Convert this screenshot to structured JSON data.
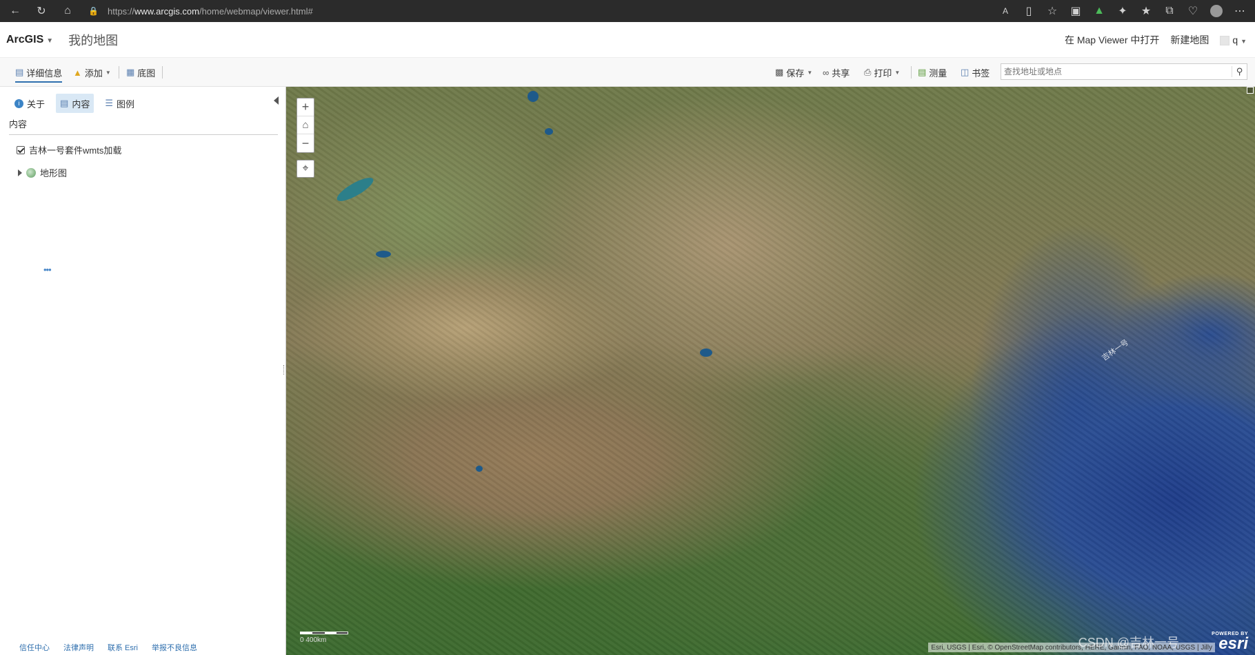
{
  "browser": {
    "url_scheme": "https://",
    "url_host": "www.arcgis.com",
    "url_path": "/home/webmap/viewer.html#"
  },
  "header": {
    "brand": "ArcGIS",
    "title": "我的地图",
    "open_in_viewer": "在 Map Viewer 中打开",
    "new_map": "新建地图",
    "user": "q"
  },
  "toolbar": {
    "details": "详细信息",
    "add": "添加",
    "basemap": "底图",
    "save": "保存",
    "share": "共享",
    "print": "打印",
    "measure": "测量",
    "bookmarks": "书签",
    "search_placeholder": "查找地址或地点"
  },
  "panel": {
    "tabs": [
      "关于",
      "内容",
      "图例"
    ],
    "section_title": "内容",
    "layers": [
      {
        "label": "吉林一号套件wmts加载",
        "checked": true
      },
      {
        "label": "地形图",
        "expandable": true
      }
    ]
  },
  "footer": {
    "links": [
      "信任中心",
      "法律声明",
      "联系 Esri",
      "举报不良信息"
    ]
  },
  "map": {
    "attribution": "Esri, USGS | Esri, © OpenStreetMap contributors, HERE, Garmin, FAO, NOAA, USGS | Jilly",
    "watermark": "CSDN @吉林一号",
    "layer_label": "吉林一号",
    "powered_by": "POWERED BY",
    "esri_logo": "esri",
    "scale_text": "0        400km"
  }
}
